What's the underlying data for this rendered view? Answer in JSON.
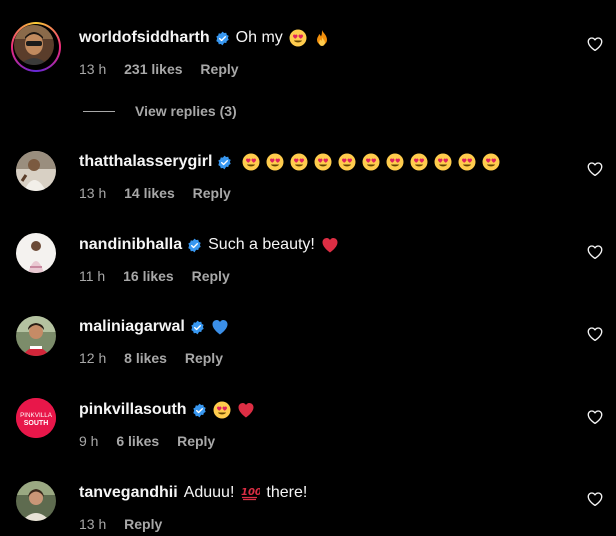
{
  "comments": [
    {
      "username": "worldofsiddharth",
      "text": "Oh my",
      "emojis": [
        "heart-eyes",
        "fire"
      ],
      "time": "13 h",
      "likes": "231 likes",
      "reply": "Reply",
      "has_story": true
    },
    {
      "username": "thatthalasserygirl",
      "text": "",
      "emojis": [
        "heart-eyes",
        "heart-eyes",
        "heart-eyes",
        "heart-eyes",
        "heart-eyes",
        "heart-eyes",
        "heart-eyes",
        "heart-eyes",
        "heart-eyes",
        "heart-eyes",
        "heart-eyes"
      ],
      "time": "13 h",
      "likes": "14 likes",
      "reply": "Reply"
    },
    {
      "username": "nandinibhalla",
      "text": "Such a beauty!",
      "emojis": [
        "red-heart"
      ],
      "time": "11 h",
      "likes": "16 likes",
      "reply": "Reply"
    },
    {
      "username": "maliniagarwal",
      "text": "",
      "emojis": [
        "blue-heart"
      ],
      "time": "12 h",
      "likes": "8 likes",
      "reply": "Reply"
    },
    {
      "username": "pinkvillasouth",
      "text": "",
      "emojis": [
        "heart-eyes",
        "red-heart"
      ],
      "time": "9 h",
      "likes": "6 likes",
      "reply": "Reply",
      "avatar_text": [
        "PINKVILLA",
        "SOUTH"
      ]
    },
    {
      "username": "tanvegandhii",
      "text_before": "Aduuu!",
      "text_after": "there!",
      "emojis": [
        "hundred-points"
      ],
      "time": "13 h",
      "likes": "",
      "reply": "Reply"
    }
  ],
  "view_replies": "View replies (3)",
  "icons": {
    "verified": "verified-badge-icon",
    "like": "heart-outline-icon"
  },
  "colors": {
    "background": "#000000",
    "primary_text": "#f5f5f5",
    "secondary_text": "#a8a8a8",
    "verified_blue": "#3897f0",
    "red_heart": "#e0245e",
    "blue_heart": "#3b8fe8",
    "pinkvilla": "#e8174a"
  }
}
